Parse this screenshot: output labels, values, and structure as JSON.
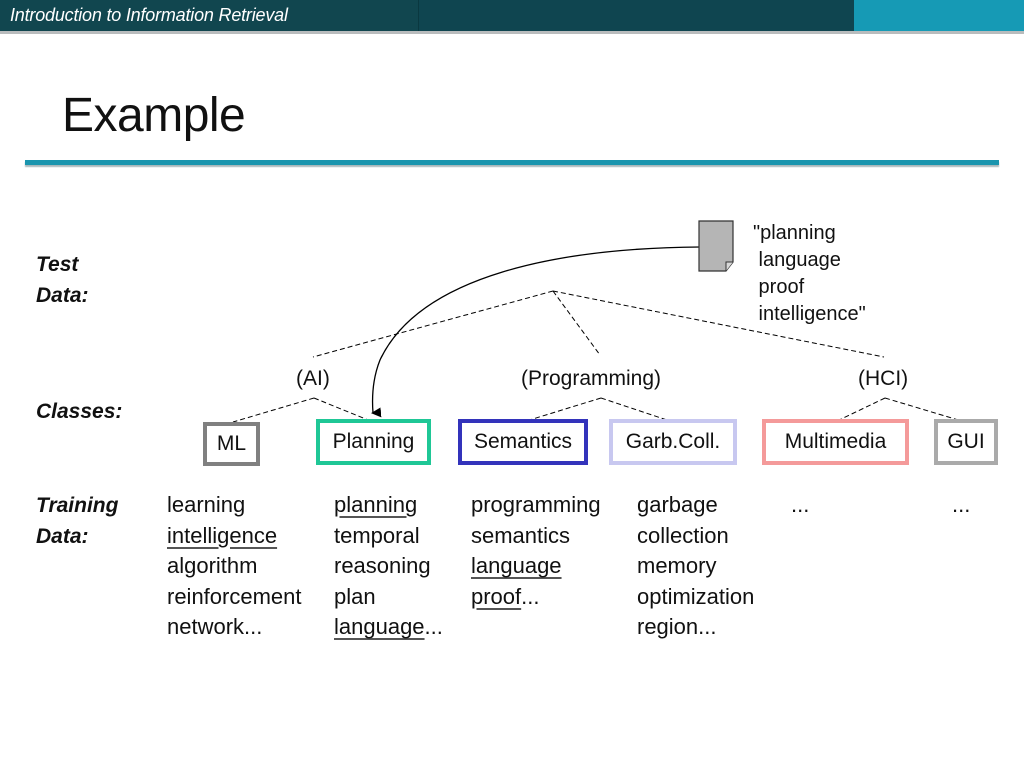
{
  "header": {
    "course_title": "Introduction to Information Retrieval",
    "colors": {
      "dark": "#11464f",
      "accent": "#169ab5"
    }
  },
  "slide": {
    "title": "Example"
  },
  "labels": {
    "test_data": [
      "Test",
      "Data:"
    ],
    "classes": "Classes:",
    "training_data": [
      "Training",
      "Data:"
    ]
  },
  "test_document": {
    "icon": "document-icon",
    "text": "\"planning\n language\n proof\n intelligence\""
  },
  "parent_classes": [
    {
      "label": "(AI)"
    },
    {
      "label": "(Programming)"
    },
    {
      "label": "(HCI)"
    }
  ],
  "classes": [
    {
      "label": "ML",
      "border_color": "#808080",
      "parent": "(AI)"
    },
    {
      "label": "Planning",
      "border_color": "#1fc796",
      "parent": "(AI)"
    },
    {
      "label": "Semantics",
      "border_color": "#3333bb",
      "parent": "(Programming)"
    },
    {
      "label": "Garb.Coll.",
      "border_color": "#c8c8f0",
      "parent": "(Programming)"
    },
    {
      "label": "Multimedia",
      "border_color": "#f49a9a",
      "parent": "(HCI)"
    },
    {
      "label": "GUI",
      "border_color": "#aaaaaa",
      "parent": "(HCI)"
    }
  ],
  "assigned_class": "Planning",
  "training_data": [
    {
      "class": "ML",
      "terms": [
        {
          "text": "learning",
          "underlined": false
        },
        {
          "text": "intelligence",
          "underlined": true
        },
        {
          "text": "algorithm",
          "underlined": false
        },
        {
          "text": "reinforcement",
          "underlined": false
        },
        {
          "text": "network...",
          "underlined": false
        }
      ]
    },
    {
      "class": "Planning",
      "terms": [
        {
          "text": "planning",
          "underlined": true
        },
        {
          "text": "temporal",
          "underlined": false
        },
        {
          "text": "reasoning",
          "underlined": false
        },
        {
          "text": "plan",
          "underlined": false
        },
        {
          "text": "language",
          "underlined": true,
          "suffix": "..."
        }
      ]
    },
    {
      "class": "Semantics",
      "terms": [
        {
          "text": "programming",
          "underlined": false
        },
        {
          "text": "semantics",
          "underlined": false
        },
        {
          "text": "language",
          "underlined": true
        },
        {
          "text": "proof",
          "underlined": true,
          "suffix": "..."
        }
      ]
    },
    {
      "class": "Garb.Coll.",
      "terms": [
        {
          "text": "garbage",
          "underlined": false
        },
        {
          "text": "collection",
          "underlined": false
        },
        {
          "text": "memory",
          "underlined": false
        },
        {
          "text": "optimization",
          "underlined": false
        },
        {
          "text": "region...",
          "underlined": false
        }
      ]
    },
    {
      "class": "Multimedia",
      "terms": [
        {
          "text": "...",
          "underlined": false
        }
      ]
    },
    {
      "class": "GUI",
      "terms": [
        {
          "text": "...",
          "underlined": false
        }
      ]
    }
  ]
}
